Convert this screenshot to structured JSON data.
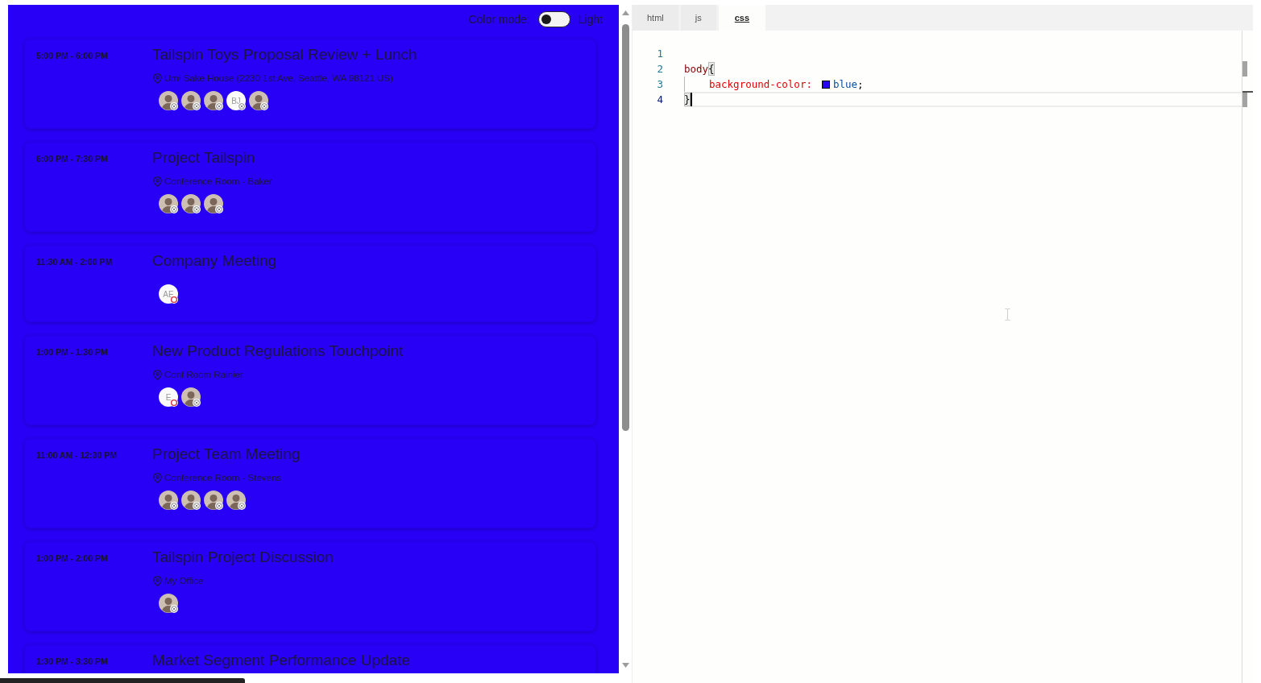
{
  "preview": {
    "color_mode": {
      "label": "Color mode:",
      "on": false,
      "state_label": "Light"
    },
    "events": [
      {
        "time": "5:00 PM - 6:00 PM",
        "title": "Tailspin Toys Proposal Review + Lunch",
        "location": "Umi Sake House (2230 1st Ave, Seattle, WA 98121 US)",
        "attendees": [
          {
            "kind": "photo",
            "presence": {
              "kind": "offline"
            }
          },
          {
            "kind": "photo",
            "presence": {
              "kind": "offline"
            }
          },
          {
            "kind": "photo",
            "presence": {
              "kind": "offline"
            }
          },
          {
            "kind": "initials",
            "initials": "BJ",
            "presence": {
              "kind": "offline"
            }
          },
          {
            "kind": "photo",
            "presence": {
              "kind": "offline"
            }
          }
        ]
      },
      {
        "time": "6:00 PM - 7:30 PM",
        "title": "Project Tailspin",
        "location": "Conference Room - Baker",
        "attendees": [
          {
            "kind": "photo",
            "presence": {
              "kind": "offline"
            }
          },
          {
            "kind": "photo",
            "presence": {
              "kind": "offline"
            }
          },
          {
            "kind": "photo",
            "presence": {
              "kind": "offline"
            }
          }
        ]
      },
      {
        "time": "11:30 AM - 2:00 PM",
        "title": "Company Meeting",
        "attendees": [
          {
            "kind": "initials",
            "initials": "AE",
            "presence": {
              "kind": "busy"
            }
          }
        ]
      },
      {
        "time": "1:00 PM - 1:30 PM",
        "title": "New Product Regulations Touchpoint",
        "location": "Conf Room Rainier",
        "attendees": [
          {
            "kind": "initials",
            "initials": "E",
            "presence": {
              "kind": "busy"
            }
          },
          {
            "kind": "photo",
            "presence": {
              "kind": "offline"
            }
          }
        ]
      },
      {
        "time": "11:00 AM - 12:30 PM",
        "title": "Project Team Meeting",
        "location": "Conference Room - Stevens",
        "attendees": [
          {
            "kind": "photo",
            "presence": {
              "kind": "offline"
            }
          },
          {
            "kind": "photo",
            "presence": {
              "kind": "offline"
            }
          },
          {
            "kind": "photo",
            "presence": {
              "kind": "offline"
            }
          },
          {
            "kind": "photo",
            "presence": {
              "kind": "offline"
            }
          }
        ]
      },
      {
        "time": "1:00 PM - 2:00 PM",
        "title": "Tailspin Project Discussion",
        "location": "My Office",
        "attendees": [
          {
            "kind": "photo",
            "presence": {
              "kind": "offline"
            }
          }
        ]
      },
      {
        "time": "1:30 PM - 3:30 PM",
        "title": "Market Segment Performance Update"
      }
    ]
  },
  "editor": {
    "tabs": [
      {
        "label": "html",
        "selected": false
      },
      {
        "label": "js",
        "selected": false
      },
      {
        "label": "css",
        "selected": true
      }
    ],
    "lines": [
      {
        "number": "1",
        "current": false
      },
      {
        "number": "2",
        "current": false,
        "tokens": [
          {
            "kind": "selector",
            "text": "body"
          },
          {
            "kind": "bracket",
            "text": "{"
          }
        ]
      },
      {
        "number": "3",
        "current": false,
        "tokens": [
          {
            "kind": "indent"
          },
          {
            "kind": "property",
            "text": "background-color:"
          },
          {
            "kind": "swatch",
            "color": "#2800f5"
          },
          {
            "kind": "value",
            "text": "blue"
          },
          {
            "kind": "punct",
            "text": ";"
          }
        ]
      },
      {
        "number": "4",
        "current": true,
        "tokens": [
          {
            "kind": "bracket",
            "text": "}"
          }
        ]
      }
    ]
  }
}
